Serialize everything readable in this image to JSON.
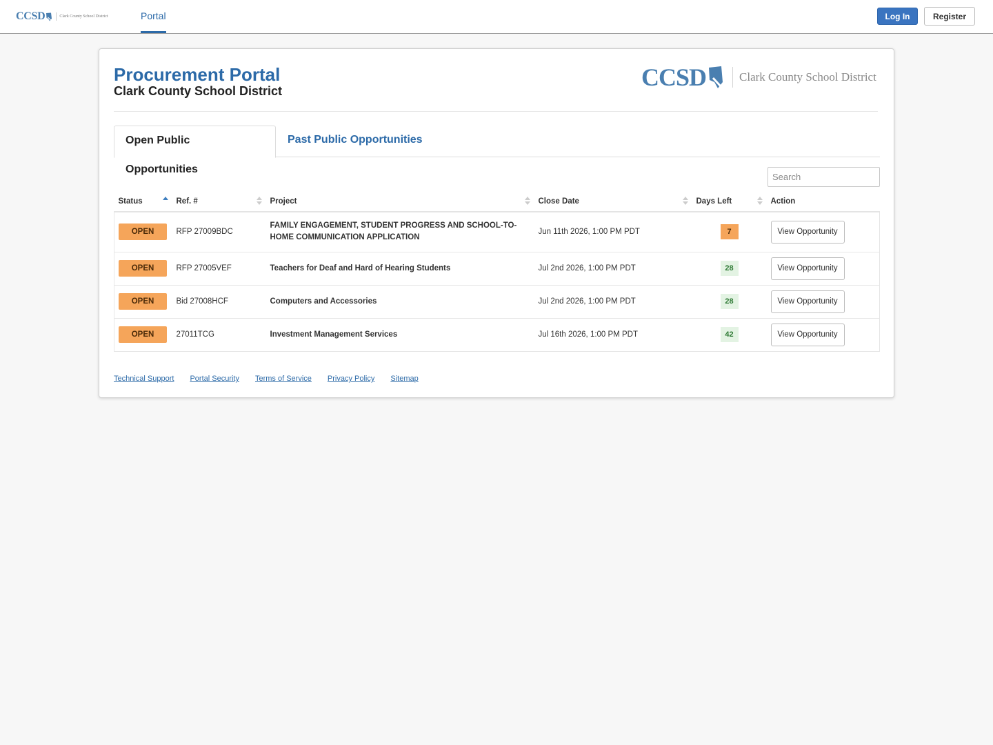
{
  "navbar": {
    "logo_mark": "CCSD",
    "logo_name": "Clark County School District",
    "portal_label": "Portal",
    "login_label": "Log In",
    "register_label": "Register"
  },
  "header": {
    "title": "Procurement Portal",
    "subtitle": "Clark County School District",
    "logo_mark": "CCSD",
    "logo_name": "Clark County School District"
  },
  "tabs": [
    {
      "label": "Open Public Opportunities",
      "active": true
    },
    {
      "label": "Past Public Opportunities",
      "active": false
    }
  ],
  "search": {
    "placeholder": "Search"
  },
  "table": {
    "columns": [
      "Status",
      "Ref. #",
      "Project",
      "Close Date",
      "Days Left",
      "Action"
    ],
    "rows": [
      {
        "status": "OPEN",
        "ref": "RFP 27009BDC",
        "project": "FAMILY ENGAGEMENT, STUDENT PROGRESS AND SCHOOL-TO-HOME COMMUNICATION APPLICATION",
        "close_date": "Jun 11th 2026, 1:00 PM PDT",
        "days_left": "7",
        "action": "View Opportunity"
      },
      {
        "status": "OPEN",
        "ref": "RFP 27005VEF",
        "project": "Teachers for Deaf and Hard of Hearing Students",
        "close_date": "Jul 2nd 2026, 1:00 PM PDT",
        "days_left": "28",
        "action": "View Opportunity"
      },
      {
        "status": "OPEN",
        "ref": "Bid 27008HCF",
        "project": "Computers and Accessories",
        "close_date": "Jul 2nd 2026, 1:00 PM PDT",
        "days_left": "28",
        "action": "View Opportunity"
      },
      {
        "status": "OPEN",
        "ref": "27011TCG",
        "project": "Investment Management Services",
        "close_date": "Jul 16th 2026, 1:00 PM PDT",
        "days_left": "42",
        "action": "View Opportunity"
      }
    ]
  },
  "footer": {
    "links": [
      "Technical Support",
      "Portal Security",
      "Terms of Service",
      "Privacy Policy",
      "Sitemap"
    ]
  },
  "colors": {
    "brand_blue": "#2c6aa8",
    "login_button": "#3a74c0",
    "open_badge": "#f5a55a",
    "days_ok_bg": "#e3f3e3",
    "days_ok_text": "#2f7a35"
  },
  "icons": [
    "shield-logo-icon",
    "sort-asc-icon",
    "sort-icon"
  ]
}
